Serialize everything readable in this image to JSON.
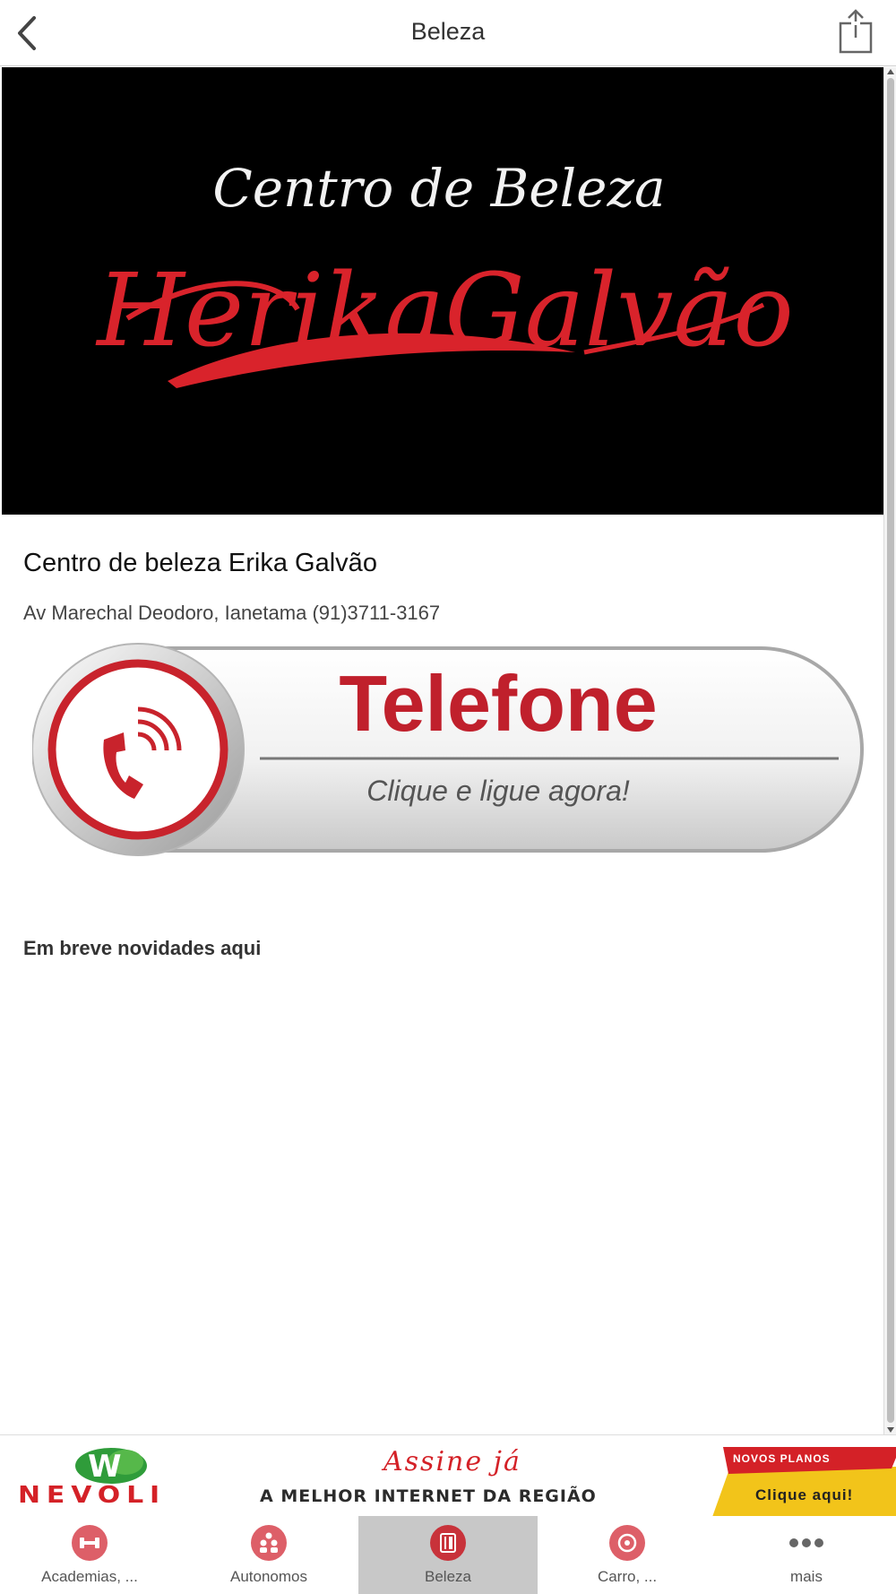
{
  "header": {
    "title": "Beleza"
  },
  "banner": {
    "line1": "Centro de Beleza",
    "line2": "HerikaGalvão"
  },
  "business": {
    "name": "Centro de beleza Erika Galvão",
    "address": "Av Marechal Deodoro, Ianetama (91)3711-3167"
  },
  "phone_button": {
    "label": "Telefone",
    "sublabel": "Clique e ligue agora!"
  },
  "news_text": "Em breve novidades aqui",
  "ad": {
    "brand": "NEVOLI",
    "headline": "Assine já",
    "tagline": "A MELHOR INTERNET DA REGIÃO",
    "promo_top": "NOVOS PLANOS",
    "promo_cta": "Clique aqui!"
  },
  "tabs": [
    {
      "label": "Academias, ...",
      "icon": "dumbbell-icon",
      "active": false
    },
    {
      "label": "Autonomos",
      "icon": "people-icon",
      "active": false
    },
    {
      "label": "Beleza",
      "icon": "beauty-icon",
      "active": true
    },
    {
      "label": "Carro, ...",
      "icon": "wheel-icon",
      "active": false
    },
    {
      "label": "mais",
      "icon": "more-icon",
      "active": false
    }
  ],
  "colors": {
    "accent": "#d42127",
    "tab_icon": "#dd5f68",
    "tab_active_bg": "#c8c8c8"
  }
}
